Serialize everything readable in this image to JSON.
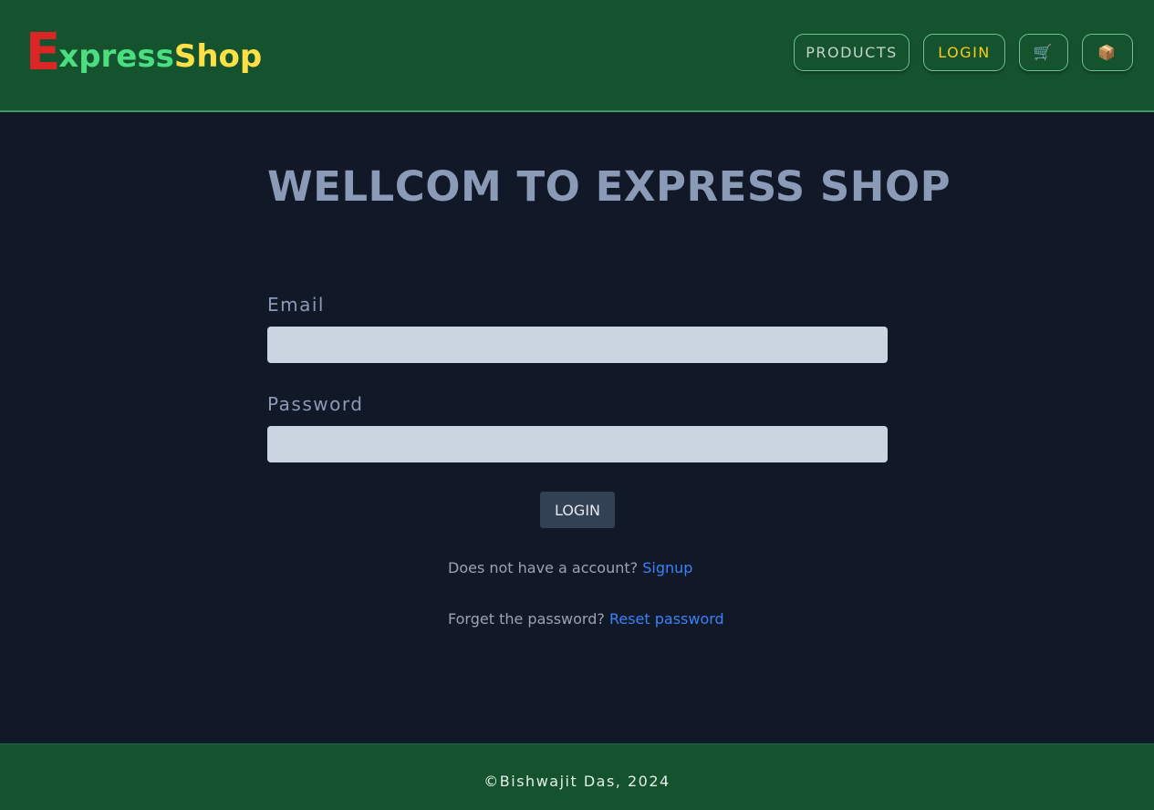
{
  "brand": {
    "first_letter": "E",
    "middle": "xpress",
    "last": "Shop"
  },
  "nav": {
    "products_label": "PRODUCTS",
    "login_label": "LOGIN",
    "cart_icon": "🛒",
    "package_icon": "📦"
  },
  "main": {
    "title": "WELLCOM TO EXPRESS SHOP",
    "email_label": "Email",
    "email_value": "",
    "password_label": "Password",
    "password_value": "",
    "login_button": "LOGIN",
    "signup_prompt": "Does not have a account?",
    "signup_link": "Signup",
    "reset_prompt": "Forget the password?",
    "reset_link": "Reset password"
  },
  "footer": {
    "text": "©Bishwajit Das, 2024"
  },
  "colors": {
    "header_bg": "#15532f",
    "page_bg": "#111827",
    "logo_e": "#dc2626",
    "logo_express": "#4ade80",
    "logo_shop": "#fde047",
    "link": "#3b82f6"
  }
}
